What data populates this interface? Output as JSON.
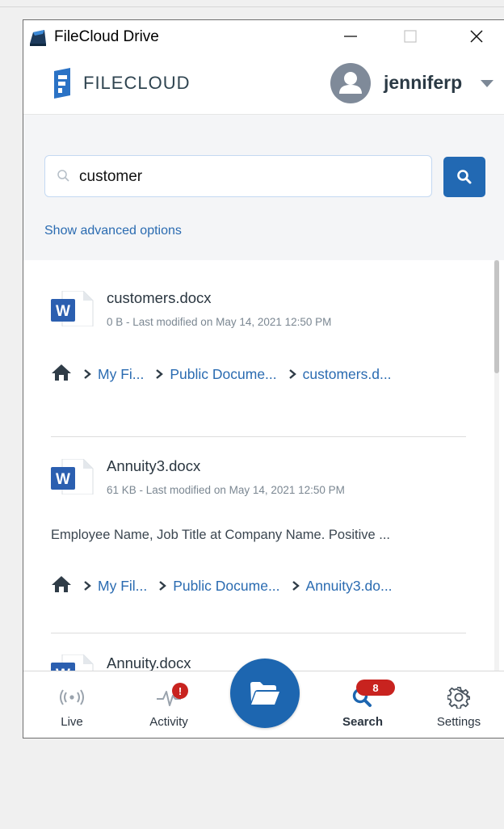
{
  "window": {
    "title": "FileCloud Drive"
  },
  "header": {
    "logo_text": "FILECLOUD",
    "username": "jenniferp"
  },
  "search": {
    "query": "customer",
    "advanced_link": "Show advanced options"
  },
  "results": [
    {
      "name": "customers.docx",
      "meta": "0 B - Last modified on May 14, 2021 12:50 PM",
      "snippet": "",
      "path": [
        "My Fi...",
        "Public Docume...",
        "customers.d..."
      ],
      "file_type_letter": "W"
    },
    {
      "name": "Annuity3.docx",
      "meta": "61 KB - Last modified on May 14, 2021 12:50 PM",
      "snippet": "Employee Name, Job Title at Company Name. Positive ...",
      "path": [
        "My Fil...",
        "Public Docume...",
        "Annuity3.do..."
      ],
      "file_type_letter": "W"
    },
    {
      "name": "Annuity.docx",
      "meta": "",
      "snippet": "",
      "path": [],
      "file_type_letter": "W"
    }
  ],
  "bottom_nav": {
    "live": "Live",
    "activity": "Activity",
    "activity_badge": "!",
    "search": "Search",
    "search_badge": "8",
    "settings": "Settings"
  },
  "colors": {
    "brand_blue": "#2269b3",
    "link_blue": "#2a6bb1",
    "badge_red": "#c8231f",
    "word_blue": "#2b5fb0"
  }
}
